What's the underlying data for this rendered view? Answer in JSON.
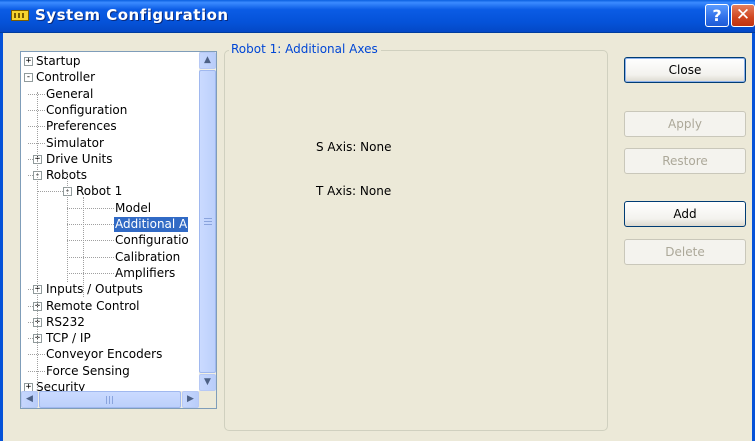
{
  "window": {
    "title": "System Configuration",
    "help_glyph": "?",
    "close_glyph": "✕"
  },
  "tree": {
    "items": [
      {
        "label": "Startup",
        "level": 0,
        "expander": "+"
      },
      {
        "label": "Controller",
        "level": 0,
        "expander": "−"
      },
      {
        "label": "General",
        "level": 1,
        "expander": ""
      },
      {
        "label": "Configuration",
        "level": 1,
        "expander": ""
      },
      {
        "label": "Preferences",
        "level": 1,
        "expander": ""
      },
      {
        "label": "Simulator",
        "level": 1,
        "expander": ""
      },
      {
        "label": "Drive Units",
        "level": 1,
        "expander": "+"
      },
      {
        "label": "Robots",
        "level": 1,
        "expander": "−"
      },
      {
        "label": "Robot 1",
        "level": 2,
        "expander": "−"
      },
      {
        "label": "Model",
        "level": 3,
        "expander": ""
      },
      {
        "label": "Additional A",
        "level": 3,
        "expander": "",
        "selected": true
      },
      {
        "label": "Configuratio",
        "level": 3,
        "expander": ""
      },
      {
        "label": "Calibration",
        "level": 3,
        "expander": ""
      },
      {
        "label": "Amplifiers",
        "level": 3,
        "expander": ""
      },
      {
        "label": "Inputs / Outputs",
        "level": 1,
        "expander": "+"
      },
      {
        "label": "Remote Control",
        "level": 1,
        "expander": "+"
      },
      {
        "label": "RS232",
        "level": 1,
        "expander": "+"
      },
      {
        "label": "TCP / IP",
        "level": 1,
        "expander": "+"
      },
      {
        "label": "Conveyor Encoders",
        "level": 1,
        "expander": ""
      },
      {
        "label": "Force Sensing",
        "level": 1,
        "expander": ""
      },
      {
        "label": "Security",
        "level": 0,
        "expander": "+"
      }
    ]
  },
  "panel": {
    "title": "Robot 1: Additional Axes",
    "s_axis": "S Axis: None",
    "t_axis": "T Axis: None"
  },
  "buttons": {
    "close": "Close",
    "apply": "Apply",
    "restore": "Restore",
    "add": "Add",
    "delete": "Delete"
  }
}
